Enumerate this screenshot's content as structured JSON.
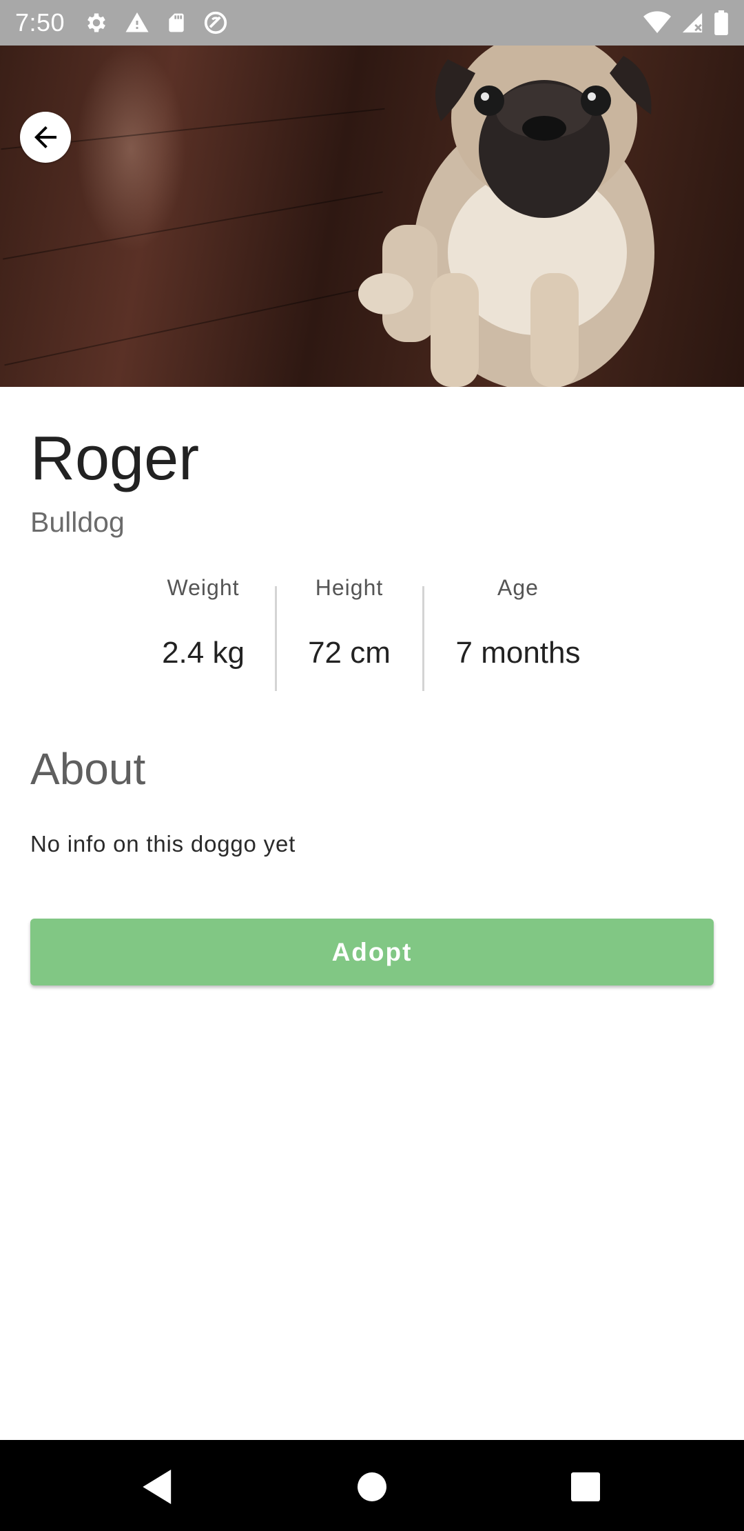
{
  "status_bar": {
    "time": "7:50",
    "left_icons": [
      "gear-icon",
      "warning-icon",
      "sd-card-icon",
      "vpn-icon"
    ],
    "right_icons": [
      "wifi-icon",
      "signal-icon",
      "battery-icon"
    ]
  },
  "hero": {
    "image": "pug-photo",
    "back_icon": "arrow-back-icon"
  },
  "dog": {
    "name": "Roger",
    "breed": "Bulldog"
  },
  "stats": {
    "weight_label": "Weight",
    "weight_value": "2.4 kg",
    "height_label": "Height",
    "height_value": "72 cm",
    "age_label": "Age",
    "age_value": "7 months"
  },
  "about": {
    "title": "About",
    "text": "No info on this doggo yet"
  },
  "actions": {
    "adopt_label": "Adopt",
    "adopt_color": "#81c784"
  },
  "nav_bar": {
    "icons": [
      "nav-back-icon",
      "nav-home-icon",
      "nav-recents-icon"
    ]
  }
}
